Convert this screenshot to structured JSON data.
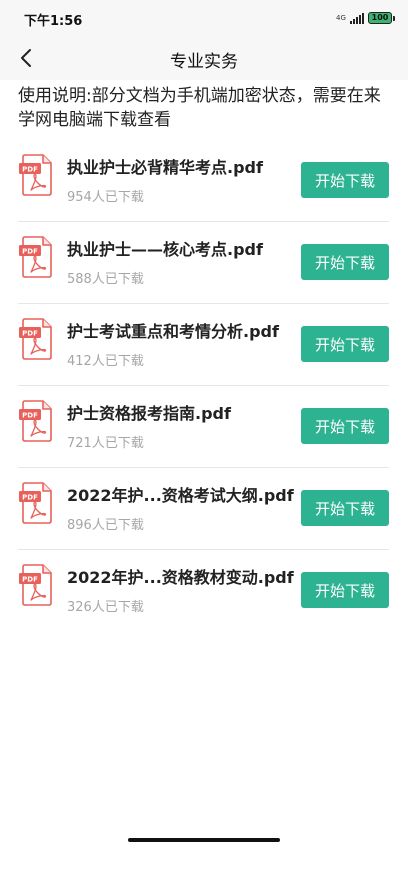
{
  "status_bar": {
    "time": "下午1:56",
    "network": "4G",
    "battery": "100"
  },
  "nav": {
    "title": "专业实务",
    "back_icon": "chevron-left-icon"
  },
  "notice": "使用说明:部分文档为手机端加密状态，需要在来学网电脑端下载查看",
  "files": [
    {
      "name": "执业护士必背精华考点.pdf",
      "count": "954人已下载",
      "button": "开始下载"
    },
    {
      "name": "执业护士——核心考点.pdf",
      "count": "588人已下载",
      "button": "开始下载"
    },
    {
      "name": "护士考试重点和考情分析.pdf",
      "count": "412人已下载",
      "button": "开始下载"
    },
    {
      "name": "护士资格报考指南.pdf",
      "count": "721人已下载",
      "button": "开始下载"
    },
    {
      "name": "2022年护...资格考试大纲.pdf",
      "count": "896人已下载",
      "button": "开始下载"
    },
    {
      "name": "2022年护...资格教材变动.pdf",
      "count": "326人已下载",
      "button": "开始下载"
    }
  ],
  "icon": {
    "pdf_label": "PDF",
    "pdf_color": "#e8605a"
  },
  "colors": {
    "accent": "#2db392",
    "nav_bg": "#f7f7f7"
  }
}
